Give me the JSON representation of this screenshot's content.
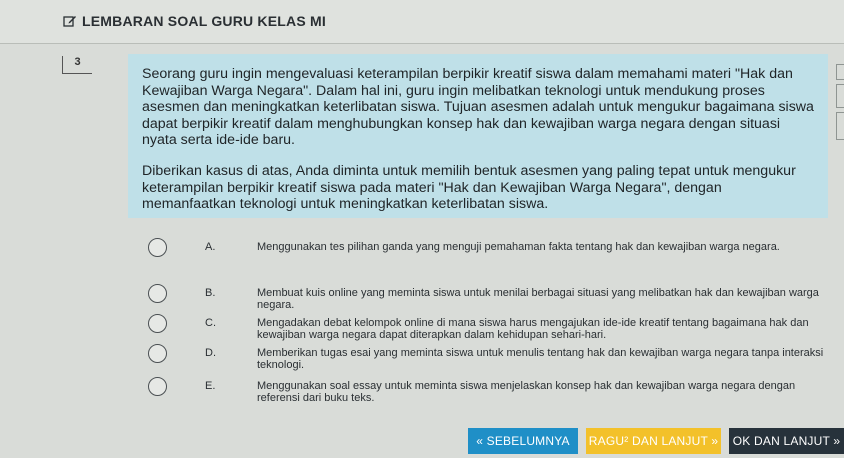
{
  "header": {
    "title": "LEMBARAN SOAL GURU KELAS MI"
  },
  "question": {
    "number": "3",
    "paragraphs": [
      "Seorang guru ingin mengevaluasi keterampilan berpikir kreatif siswa dalam memahami materi \"Hak dan Kewajiban Warga Negara\". Dalam hal ini, guru ingin melibatkan teknologi untuk mendukung proses asesmen dan meningkatkan keterlibatan siswa. Tujuan asesmen adalah untuk mengukur bagaimana siswa dapat berpikir kreatif dalam menghubungkan konsep hak dan kewajiban warga negara dengan situasi nyata serta ide-ide baru.",
      "Diberikan kasus di atas, Anda diminta untuk memilih bentuk asesmen yang paling tepat untuk mengukur keterampilan berpikir kreatif siswa pada materi \"Hak dan Kewajiban Warga Negara\", dengan memanfaatkan teknologi untuk meningkatkan keterlibatan siswa."
    ]
  },
  "options": [
    {
      "letter": "A.",
      "text": "Menggunakan tes pilihan ganda yang menguji pemahaman fakta tentang hak dan kewajiban warga negara."
    },
    {
      "letter": "B.",
      "text": "Membuat kuis online yang meminta siswa untuk menilai berbagai situasi yang melibatkan hak dan kewajiban warga negara."
    },
    {
      "letter": "C.",
      "text": "Mengadakan debat kelompok online di mana siswa harus mengajukan ide-ide kreatif tentang bagaimana hak dan kewajiban warga negara dapat diterapkan dalam kehidupan sehari-hari."
    },
    {
      "letter": "D.",
      "text": "Memberikan tugas esai yang meminta siswa untuk menulis tentang hak dan kewajiban warga negara tanpa interaksi teknologi."
    },
    {
      "letter": "E.",
      "text": "Menggunakan soal essay untuk meminta siswa menjelaskan konsep hak dan kewajiban warga negara dengan referensi dari buku teks."
    }
  ],
  "footer": {
    "prev_label": "« SEBELUMNYA",
    "ragu_label": "RAGU² DAN LANJUT »",
    "ok_label": "OK DAN LANJUT »"
  },
  "colors": {
    "question_bg": "#bfe0e8",
    "prev_button": "#1f8fc7",
    "ragu_button": "#f3c12a",
    "ok_button": "#27323b"
  }
}
